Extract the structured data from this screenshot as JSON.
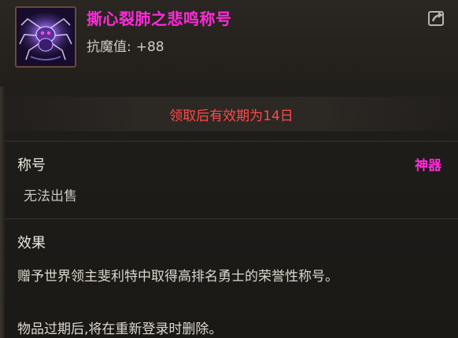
{
  "item": {
    "name": "撕心裂肺之悲鸣称号",
    "name_color": "#ff2bd8",
    "stat_label": "抗魔值:",
    "stat_value": "+88",
    "icon": "purple-spider-title-icon"
  },
  "expiry": {
    "text": "领取后有效期为14日",
    "color": "#ff4a4a"
  },
  "type_section": {
    "heading": "称号",
    "grade": "神器",
    "trade_status": "无法出售"
  },
  "effect_section": {
    "heading": "效果",
    "description": "赠予世界领主斐利特中取得高排名勇士的荣誉性称号。",
    "note": "物品过期后,将在重新登录时删除。"
  },
  "actions": {
    "share_icon": "share-arrow-icon"
  }
}
